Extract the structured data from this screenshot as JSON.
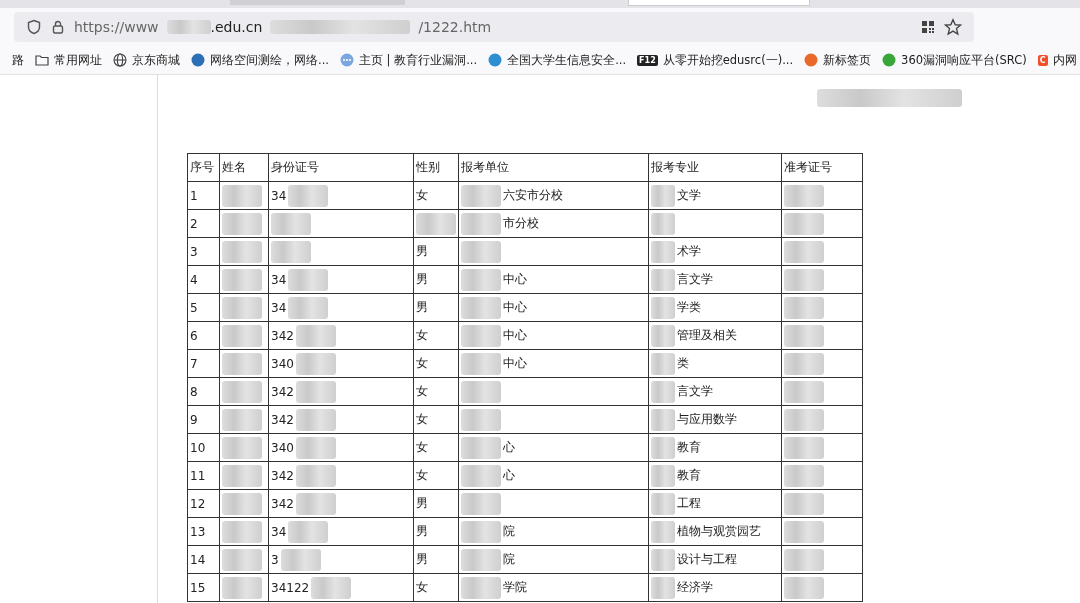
{
  "address_bar": {
    "url_parts": [
      "https://www",
      ".edu.cn",
      "/1222.htm"
    ]
  },
  "bookmarks": [
    {
      "kind": "text",
      "label": "路"
    },
    {
      "kind": "folder",
      "label": "常用网址"
    },
    {
      "kind": "globe",
      "label": "京东商城"
    },
    {
      "kind": "circle",
      "label": "网络空间测绘，网络...",
      "color": "#2c6fb5"
    },
    {
      "kind": "dots",
      "label": "主页 | 教育行业漏洞...",
      "color": "#7aa7e0"
    },
    {
      "kind": "circle",
      "label": "全国大学生信息安全...",
      "color": "#2e8fd0"
    },
    {
      "kind": "badge",
      "badge": "F12",
      "label": "从零开始挖edusrc(一)...",
      "color": "#222222"
    },
    {
      "kind": "circle",
      "label": "新标签页",
      "color": "#e8692a"
    },
    {
      "kind": "circle",
      "label": "360漏洞响应平台(SRC)",
      "color": "#3aa63a"
    },
    {
      "kind": "badge",
      "badge": "C",
      "label": "内网",
      "color": "#f0502a"
    }
  ],
  "table": {
    "columns": [
      "序号",
      "姓名",
      "身份证号",
      "性别",
      "报考单位",
      "报考专业",
      "准考证号"
    ],
    "rows": [
      {
        "no": "1",
        "id": "34",
        "gender": "女",
        "unit": "六安市分校",
        "major": "文学"
      },
      {
        "no": "2",
        "id": "",
        "gender": "",
        "unit": "市分校",
        "major": ""
      },
      {
        "no": "3",
        "id": "",
        "gender": "男",
        "unit": "",
        "major": "术学"
      },
      {
        "no": "4",
        "id": "34",
        "gender": "男",
        "unit": "中心",
        "major": "言文学"
      },
      {
        "no": "5",
        "id": "34",
        "gender": "男",
        "unit": "中心",
        "major": "学类"
      },
      {
        "no": "6",
        "id": "342",
        "gender": "女",
        "unit": "中心",
        "major": "管理及相关"
      },
      {
        "no": "7",
        "id": "340",
        "gender": "女",
        "unit": "中心",
        "major": "类"
      },
      {
        "no": "8",
        "id": "342",
        "gender": "女",
        "unit": "",
        "major": "言文学"
      },
      {
        "no": "9",
        "id": "342",
        "gender": "女",
        "unit": "",
        "major": "与应用数学"
      },
      {
        "no": "10",
        "id": "340",
        "gender": "女",
        "unit": "心",
        "major": "教育"
      },
      {
        "no": "11",
        "id": "342",
        "gender": "女",
        "unit": "心",
        "major": "教育"
      },
      {
        "no": "12",
        "id": "342",
        "gender": "男",
        "unit": "",
        "major": "工程"
      },
      {
        "no": "13",
        "id": "34",
        "gender": "男",
        "unit": "院",
        "major": "植物与观赏园艺"
      },
      {
        "no": "14",
        "id": "3",
        "gender": "男",
        "unit": "院",
        "major": "设计与工程"
      },
      {
        "no": "15",
        "id": "34122",
        "gender": "女",
        "unit": "学院",
        "major": "经济学"
      }
    ]
  }
}
